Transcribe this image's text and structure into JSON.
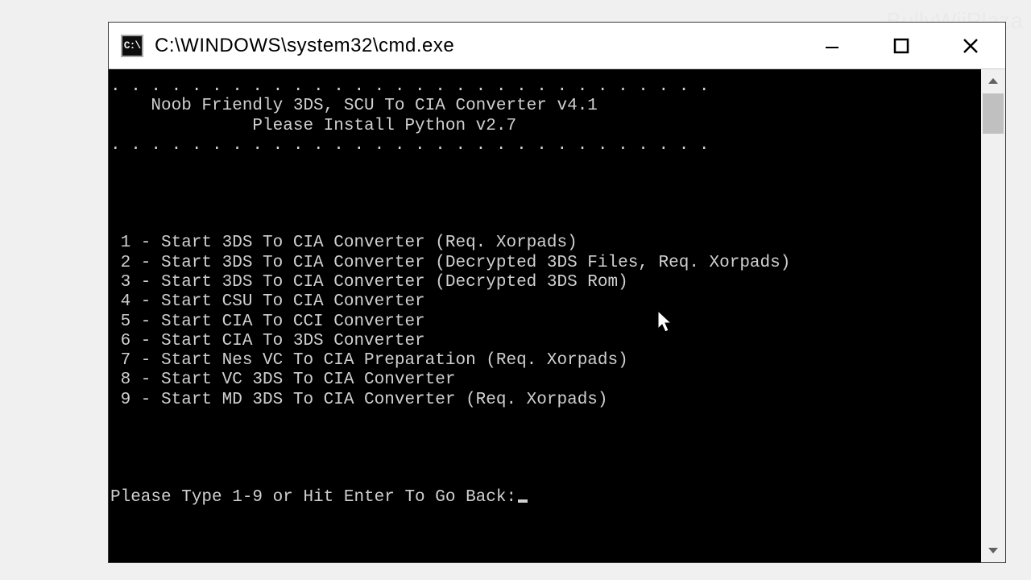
{
  "window": {
    "title": "C:\\WINDOWS\\system32\\cmd.exe",
    "icon_text": "C:\\"
  },
  "console": {
    "border": ". . . . . . . . . . . . . . . . . . . . . . . . . . . . . .",
    "header1": "    Noob Friendly 3DS, SCU To CIA Converter v4.1",
    "header2": "              Please Install Python v2.7",
    "menu": [
      " 1 - Start 3DS To CIA Converter (Req. Xorpads)",
      " 2 - Start 3DS To CIA Converter (Decrypted 3DS Files, Req. Xorpads)",
      " 3 - Start 3DS To CIA Converter (Decrypted 3DS Rom)",
      " 4 - Start CSU To CIA Converter",
      " 5 - Start CIA To CCI Converter",
      " 6 - Start CIA To 3DS Converter",
      " 7 - Start Nes VC To CIA Preparation (Req. Xorpads)",
      " 8 - Start VC 3DS To CIA Converter",
      " 9 - Start MD 3DS To CIA Converter (Req. Xorpads)"
    ],
    "prompt": "Please Type 1-9 or Hit Enter To Go Back:"
  },
  "watermark": "BullyWiiPlaza"
}
